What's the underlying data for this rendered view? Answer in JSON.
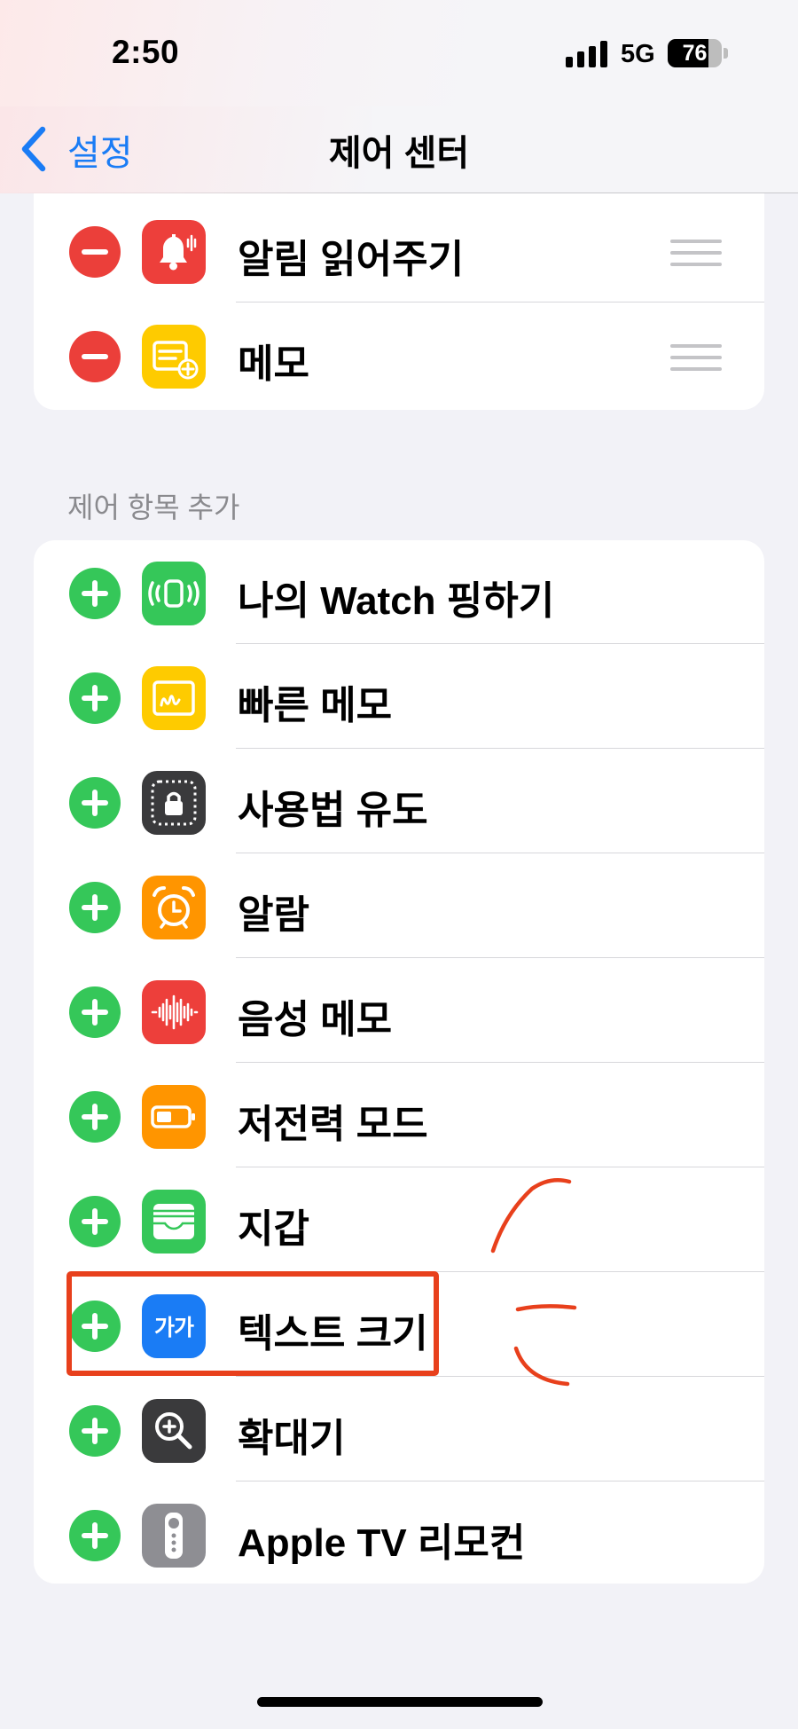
{
  "status_bar": {
    "time": "2:50",
    "network": "5G",
    "battery_percent": "76",
    "battery_level": 0.76
  },
  "nav": {
    "back_label": "설정",
    "title": "제어 센터"
  },
  "included_controls": [
    {
      "label": "알림 읽어주기",
      "icon": "announce-notifications-icon",
      "color": "#ed3f3b"
    },
    {
      "label": "메모",
      "icon": "notes-icon",
      "color": "#fecb00"
    }
  ],
  "more_controls": {
    "header": "제어 항목 추가",
    "items": [
      {
        "label": "나의 Watch 핑하기",
        "icon": "ping-watch-icon",
        "color": "#35c759"
      },
      {
        "label": "빠른 메모",
        "icon": "quick-note-icon",
        "color": "#fecb00"
      },
      {
        "label": "사용법 유도",
        "icon": "guided-access-icon",
        "color": "#3a3a3c"
      },
      {
        "label": "알람",
        "icon": "alarm-icon",
        "color": "#ff9500"
      },
      {
        "label": "음성 메모",
        "icon": "voice-memos-icon",
        "color": "#ed3f3b"
      },
      {
        "label": "저전력 모드",
        "icon": "low-power-mode-icon",
        "color": "#ff9500"
      },
      {
        "label": "지갑",
        "icon": "wallet-icon",
        "color": "#35c759"
      },
      {
        "label": "텍스트 크기",
        "icon": "text-size-icon",
        "color": "#1a7cf5",
        "icon_text": "가가"
      },
      {
        "label": "확대기",
        "icon": "magnifier-icon",
        "color": "#3a3a3c"
      },
      {
        "label": "Apple TV 리모컨",
        "icon": "apple-tv-remote-icon",
        "color": "#8e8e93"
      }
    ]
  },
  "annotation": {
    "color": "#e8401c",
    "highlighted_item": "텍스트 크기"
  }
}
